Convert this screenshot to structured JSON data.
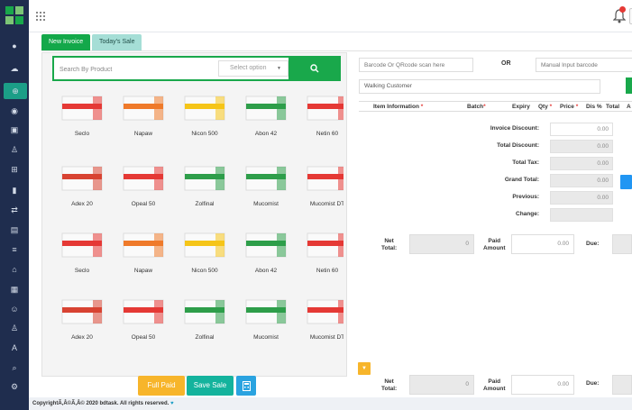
{
  "tabs": {
    "new_invoice": "New Invoice",
    "todays_sale": "Today's Sale"
  },
  "search": {
    "placeholder": "Search By Product",
    "select_placeholder": "Select option"
  },
  "products": [
    {
      "name": "Seclo",
      "color": "#e53935"
    },
    {
      "name": "Napaw",
      "color": "#ef7a2a"
    },
    {
      "name": "Nicon 500",
      "color": "#f5c518"
    },
    {
      "name": "Abon 42",
      "color": "#2e9e4a"
    },
    {
      "name": "Netin 60",
      "color": "#e53935"
    },
    {
      "name": "Adex 20",
      "color": "#d84332"
    },
    {
      "name": "Opeal 50",
      "color": "#e53935"
    },
    {
      "name": "Zolfinal",
      "color": "#2e9e4a"
    },
    {
      "name": "Mucomist",
      "color": "#2e9e4a"
    },
    {
      "name": "Mucomist DT",
      "color": "#e53935"
    },
    {
      "name": "Seclo",
      "color": "#e53935"
    },
    {
      "name": "Napaw",
      "color": "#ef7a2a"
    },
    {
      "name": "Nicon 500",
      "color": "#f5c518"
    },
    {
      "name": "Abon 42",
      "color": "#2e9e4a"
    },
    {
      "name": "Netin 60",
      "color": "#e53935"
    },
    {
      "name": "Adex 20",
      "color": "#d84332"
    },
    {
      "name": "Opeal 50",
      "color": "#e53935"
    },
    {
      "name": "Zolfinal",
      "color": "#2e9e4a"
    },
    {
      "name": "Mucomist",
      "color": "#2e9e4a"
    },
    {
      "name": "Mucomist DT",
      "color": "#e53935"
    }
  ],
  "buttons": {
    "full_paid": "Full Paid",
    "save_sale": "Save Sale"
  },
  "invoice": {
    "barcode_placeholder": "Barcode Or QRcode scan here",
    "or_label": "OR",
    "manual_placeholder": "Manual Input barcode",
    "customer_value": "Walking Customer",
    "columns": {
      "item": "Item Information",
      "batch": "Batch",
      "expiry": "Expiry",
      "qty": "Qty",
      "price": "Price",
      "dis": "Dis %",
      "total": "Total",
      "action": "A"
    },
    "required_mark": "*",
    "summary": [
      {
        "label": "Invoice Discount:",
        "value": "0.00",
        "style": "white"
      },
      {
        "label": "Total Discount:",
        "value": "0.00",
        "style": "grey"
      },
      {
        "label": "Total Tax:",
        "value": "0.00",
        "style": "grey"
      },
      {
        "label": "Grand Total:",
        "value": "0.00",
        "style": "grey"
      },
      {
        "label": "Previous:",
        "value": "0.00",
        "style": "grey"
      },
      {
        "label": "Change:",
        "value": "",
        "style": "grey"
      }
    ],
    "net_total_label_1": "Net",
    "net_total_label_2": "Total:",
    "net_total_value": "0",
    "paid_label_1": "Paid",
    "paid_label_2": "Amount",
    "paid_value": "0.00",
    "due_label": "Due:"
  },
  "footer": {
    "text": "CopyrightÃ‚Â©Ã‚Â© 2020 bdtask. All rights reserved."
  },
  "colors": {
    "sidebar": "#1f2d4e",
    "accent_green": "#19a84b",
    "accent_teal": "#14b39d",
    "accent_orange": "#f7b52b",
    "accent_blue": "#2aa3e0"
  }
}
